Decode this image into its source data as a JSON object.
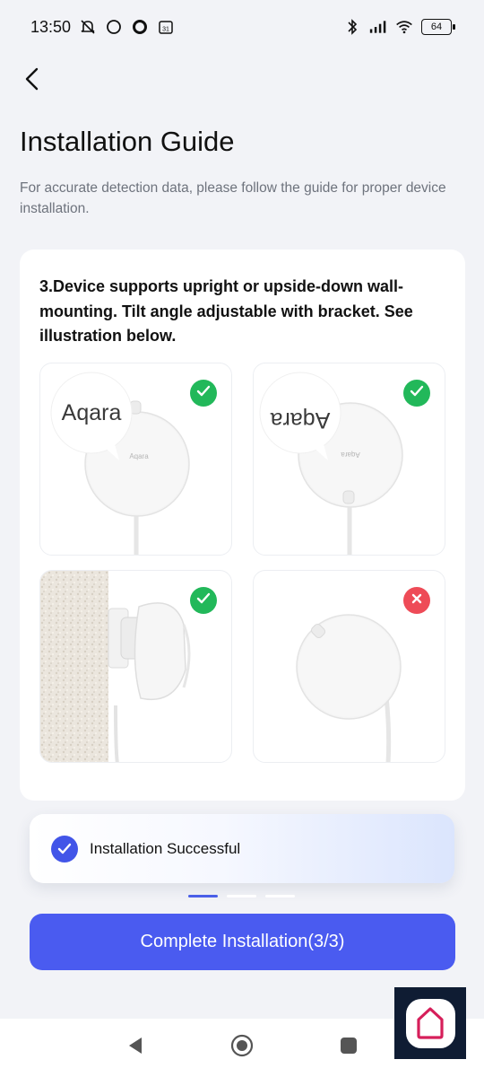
{
  "status_bar": {
    "time": "13:50",
    "battery": "64"
  },
  "header": {
    "back_icon": "chevron-left-icon",
    "title": "Installation Guide",
    "subtitle": "For accurate detection data, please follow the guide for proper device installation."
  },
  "card": {
    "step_text": "3.Device supports upright or upside-down wall-mounting. Tilt angle adjustable with bracket. See illustration below.",
    "illustrations": [
      {
        "logo": "Aqara",
        "state": "correct",
        "badge_icon": "check-icon"
      },
      {
        "logo": "Aqara",
        "state": "correct",
        "badge_icon": "check-icon"
      },
      {
        "logo": "",
        "state": "correct",
        "badge_icon": "check-icon"
      },
      {
        "logo": "",
        "state": "incorrect",
        "badge_icon": "close-icon"
      }
    ]
  },
  "toast": {
    "label": "Installation Successful",
    "icon": "check-circle-icon"
  },
  "pager": {
    "total": 3,
    "active": 1
  },
  "primary_button": {
    "label": "Complete Installation(3/3)"
  },
  "colors": {
    "accent": "#4a5bf0",
    "success": "#22b85a",
    "error": "#ee4b57",
    "background": "#f2f3f7"
  }
}
